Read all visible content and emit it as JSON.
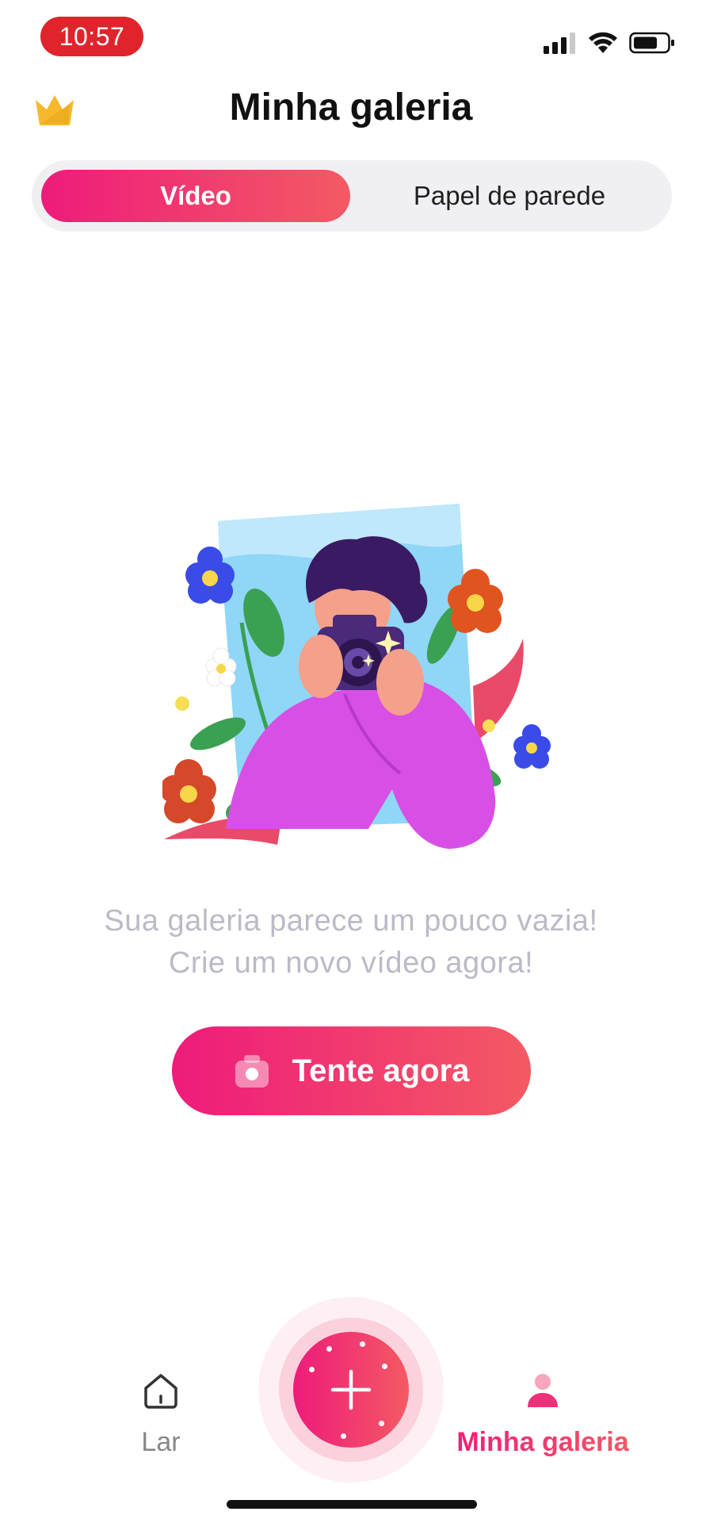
{
  "status_bar": {
    "time": "10:57"
  },
  "header": {
    "title": "Minha galeria",
    "premium_icon": "crown-icon"
  },
  "tabs": [
    {
      "label": "Vídeo",
      "selected": true
    },
    {
      "label": "Papel de parede",
      "selected": false
    }
  ],
  "empty_state": {
    "line1": "Sua galeria parece um pouco vazia!",
    "line2": "Crie um novo vídeo agora!",
    "illustration": "photographer-illustration"
  },
  "cta": {
    "label": "Tente agora",
    "icon": "camera-icon"
  },
  "bottom_nav": {
    "home_label": "Lar",
    "home_icon": "home-icon",
    "create_icon": "plus-icon",
    "gallery_label": "Minha galeria",
    "gallery_icon": "user-icon",
    "active": "gallery"
  },
  "colors": {
    "accent_start": "#ee1b7b",
    "accent_end": "#f45a63",
    "time_badge": "#e0242c",
    "crown": "#f6b92b",
    "muted_text": "#bdb9c6"
  }
}
